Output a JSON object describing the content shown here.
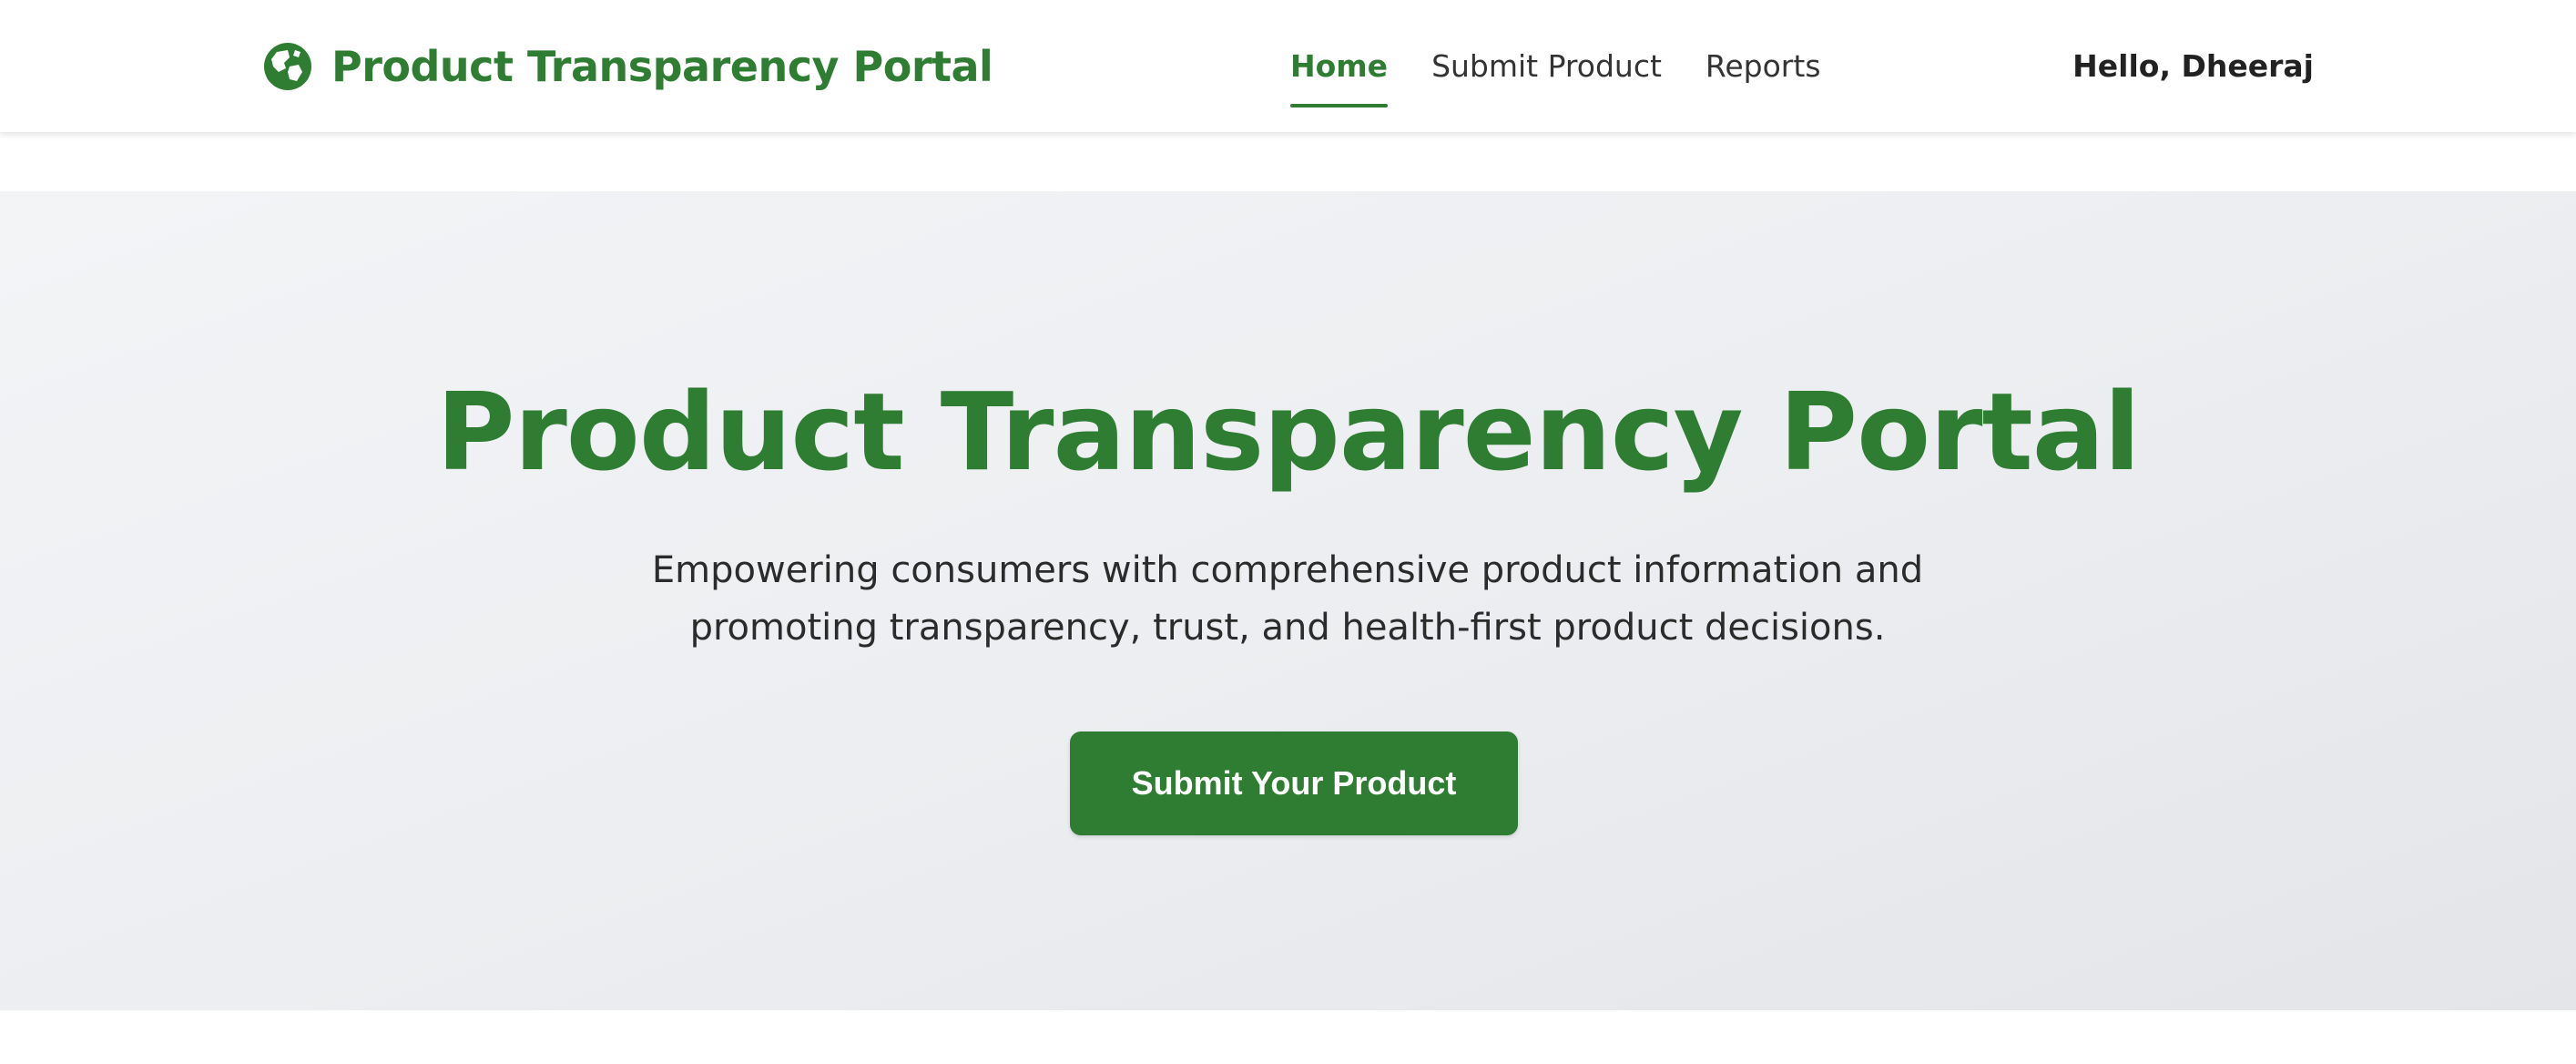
{
  "header": {
    "brand_name": "Product Transparency Portal",
    "logo_icon": "globe-icon",
    "nav": [
      {
        "label": "Home",
        "active": true
      },
      {
        "label": "Submit Product",
        "active": false
      },
      {
        "label": "Reports",
        "active": false
      }
    ],
    "greeting": "Hello, Dheeraj"
  },
  "hero": {
    "title": "Product Transparency Portal",
    "subtitle": "Empowering consumers with comprehensive product information and promoting transparency, trust, and health-first product decisions.",
    "cta_label": "Submit Your Product"
  },
  "colors": {
    "brand_green": "#2e7d32",
    "text_dark": "#2b2b2b",
    "hero_bg": "#eceef1",
    "header_bg": "#ffffff"
  }
}
